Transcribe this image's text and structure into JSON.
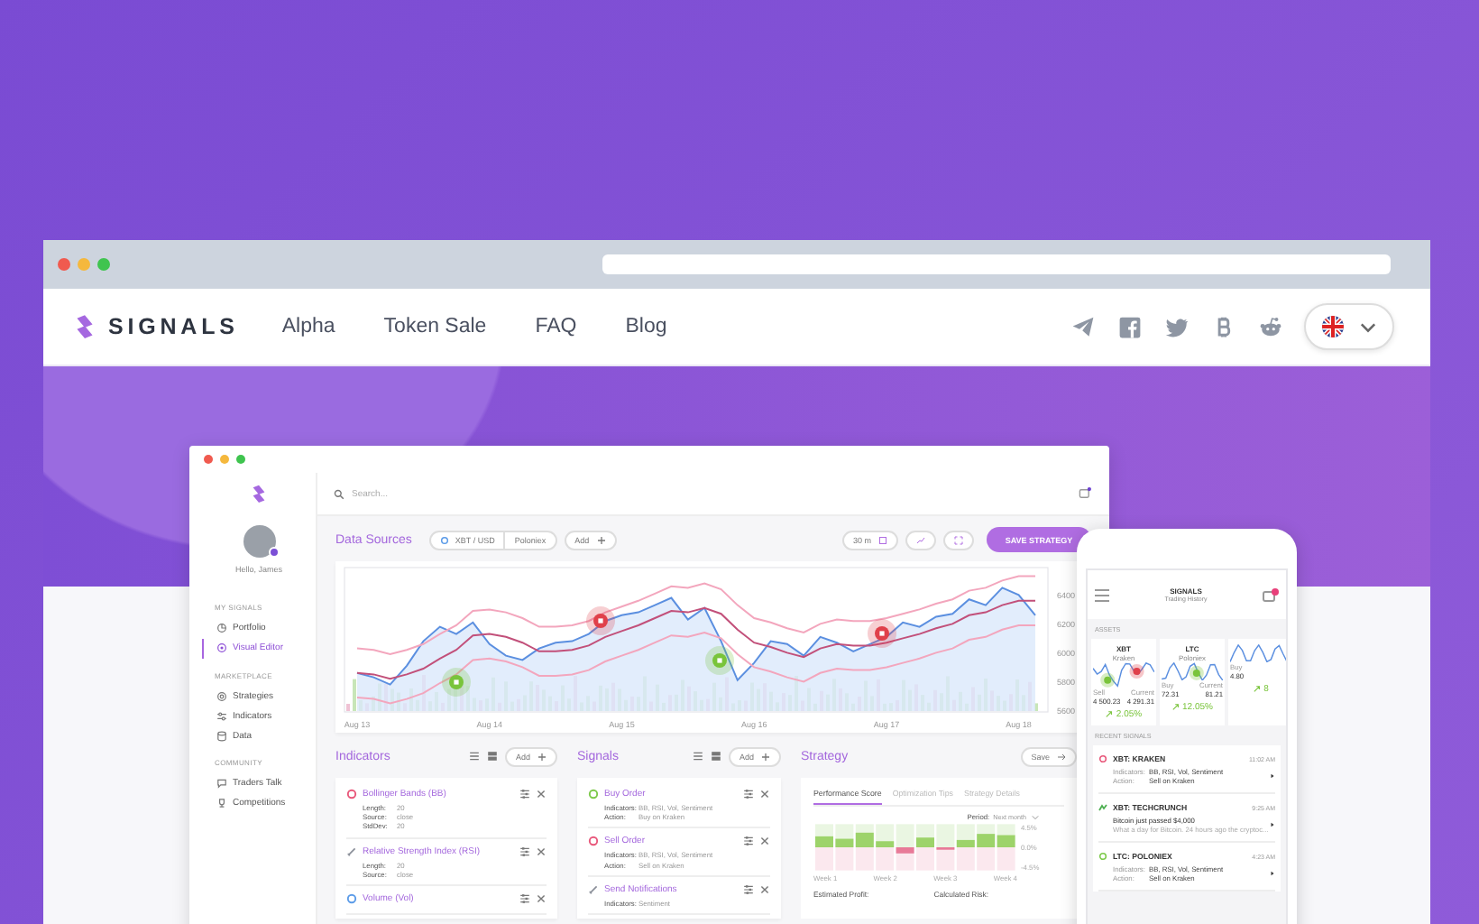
{
  "nav": {
    "logo": "SIGNALS",
    "links": [
      "Alpha",
      "Token Sale",
      "FAQ",
      "Blog"
    ]
  },
  "dashboard": {
    "search": {
      "placeholder": "Search..."
    },
    "user": {
      "greeting": "Hello, James"
    },
    "sidebar": [
      {
        "heading": "MY SIGNALS",
        "items": [
          {
            "label": "Portfolio",
            "selected": false
          },
          {
            "label": "Visual Editor",
            "selected": true
          }
        ]
      },
      {
        "heading": "MARKETPLACE",
        "items": [
          {
            "label": "Strategies",
            "selected": false
          },
          {
            "label": "Indicators",
            "selected": false
          },
          {
            "label": "Data",
            "selected": false
          }
        ]
      },
      {
        "heading": "COMMUNITY",
        "items": [
          {
            "label": "Traders Talk",
            "selected": false
          },
          {
            "label": "Competitions",
            "selected": false
          }
        ]
      }
    ],
    "data_sources": {
      "title": "Data Sources",
      "pair": "XBT / USD",
      "exchange": "Poloniex",
      "add": "Add",
      "interval": "30 m",
      "save": "SAVE STRATEGY"
    },
    "chart": {
      "chart_data": {
        "type": "line",
        "categories": [
          "Aug 13",
          null,
          null,
          null,
          null,
          null,
          null,
          null,
          "Aug 14",
          null,
          null,
          null,
          null,
          null,
          null,
          null,
          "Aug 15",
          null,
          null,
          null,
          null,
          null,
          null,
          null,
          "Aug 16",
          null,
          null,
          null,
          null,
          null,
          null,
          null,
          "Aug 17",
          null,
          null,
          null,
          null,
          null,
          null,
          null,
          "Aug 18",
          null
        ],
        "ylim": [
          5600,
          6600
        ],
        "yticks": [
          6400,
          6200,
          6000,
          5800,
          5600
        ],
        "series": [
          {
            "color": "#5b8fe0",
            "values": [
              5870,
              5840,
              5790,
              5920,
              6090,
              6190,
              6140,
              6220,
              6070,
              5990,
              5960,
              6040,
              6080,
              6090,
              6140,
              6230,
              6270,
              6290,
              6340,
              6390,
              6240,
              6320,
              6090,
              5820,
              5940,
              6090,
              6070,
              5990,
              6120,
              6080,
              6020,
              6070,
              6120,
              6220,
              6190,
              6260,
              6280,
              6380,
              6340,
              6460,
              6410,
              6270
            ]
          },
          {
            "color": "#f3a6bd",
            "values": [
              6040,
              6030,
              6000,
              6030,
              6070,
              6140,
              6200,
              6300,
              6310,
              6290,
              6250,
              6190,
              6190,
              6200,
              6230,
              6290,
              6330,
              6370,
              6420,
              6470,
              6460,
              6490,
              6450,
              6340,
              6250,
              6220,
              6180,
              6150,
              6210,
              6240,
              6230,
              6230,
              6250,
              6280,
              6310,
              6350,
              6380,
              6440,
              6460,
              6510,
              6540,
              6540
            ]
          },
          {
            "color": "#c2507a",
            "values": [
              5870,
              5860,
              5830,
              5860,
              5900,
              5970,
              6030,
              6130,
              6140,
              6120,
              6080,
              6020,
              6020,
              6030,
              6060,
              6120,
              6160,
              6200,
              6250,
              6300,
              6290,
              6320,
              6280,
              6170,
              6080,
              6050,
              6010,
              5980,
              6040,
              6070,
              6060,
              6060,
              6080,
              6110,
              6140,
              6180,
              6210,
              6270,
              6290,
              6340,
              6370,
              6370
            ]
          },
          {
            "color": "#f3a6bd",
            "values": [
              5700,
              5690,
              5660,
              5690,
              5730,
              5800,
              5860,
              5960,
              5970,
              5950,
              5910,
              5850,
              5850,
              5860,
              5890,
              5950,
              5990,
              6030,
              6080,
              6130,
              6120,
              6150,
              6110,
              6000,
              5910,
              5880,
              5840,
              5810,
              5870,
              5900,
              5890,
              5890,
              5910,
              5940,
              5970,
              6010,
              6040,
              6100,
              6120,
              6170,
              6200,
              6200
            ]
          }
        ]
      }
    },
    "indicators": {
      "title": "Indicators",
      "add": "Add",
      "items": [
        {
          "name": "Bollinger Bands (BB)",
          "kind": "dot",
          "color": "#e8577a",
          "params": [
            {
              "label": "Length:",
              "value": "20"
            },
            {
              "label": "Source:",
              "value": "close"
            },
            {
              "label": "StdDev:",
              "value": "20"
            }
          ]
        },
        {
          "name": "Relative Strength Index (RSI)",
          "kind": "pen",
          "color": "#8a8f99",
          "params": [
            {
              "label": "Length:",
              "value": "20"
            },
            {
              "label": "Source:",
              "value": "close"
            }
          ]
        },
        {
          "name": "Volume (Vol)",
          "kind": "dot",
          "color": "#5b9be8"
        }
      ]
    },
    "signals": {
      "title": "Signals",
      "add": "Add",
      "items": [
        {
          "name": "Buy Order",
          "kind": "dot",
          "color": "#7cc94a",
          "params": [
            {
              "label": "Indicators:",
              "value": "BB, RSI, Vol, Sentiment"
            },
            {
              "label": "Action:",
              "value": "Buy on Kraken"
            }
          ]
        },
        {
          "name": "Sell Order",
          "kind": "dot",
          "color": "#e8577a",
          "params": [
            {
              "label": "Indicators:",
              "value": "BB, RSI, Vol, Sentiment"
            },
            {
              "label": "Action:",
              "value": "Sell on Kraken"
            }
          ]
        },
        {
          "name": "Send Notifications",
          "kind": "pen",
          "color": "#8a8f99",
          "params": [
            {
              "label": "Indicators:",
              "value": "Sentiment"
            }
          ]
        }
      ]
    },
    "strategy": {
      "title": "Strategy",
      "save": "Save",
      "tabs": [
        {
          "label": "Performance Score",
          "selected": true
        },
        {
          "label": "Optimization Tips",
          "selected": false
        },
        {
          "label": "Strategy Details",
          "selected": false
        }
      ],
      "period_label": "Period:",
      "period": "Next month",
      "y_labels": [
        "4.5%",
        "0.0%",
        "-4.5%"
      ],
      "week_labels": [
        "Week 1",
        "Week 2",
        "Week 3",
        "Week 4"
      ],
      "footer": [
        "Estimated Profit:",
        "Calculated Risk:"
      ]
    }
  },
  "phone": {
    "title": "SIGNALS",
    "subtitle": "Trading History",
    "assets_heading": "ASSETS",
    "assets": [
      {
        "symbol": "XBT",
        "exchange": "Kraken",
        "left_label": "Sell",
        "left_value": "4 500.23",
        "right_label": "Current",
        "right_value": "4 291.31",
        "change": "2.05%"
      },
      {
        "symbol": "LTC",
        "exchange": "Poloniex",
        "left_label": "Buy",
        "left_value": "72.31",
        "right_label": "Current",
        "right_value": "81.21",
        "change": "12.05%"
      },
      {
        "left_label": "Buy",
        "left_value": "4.80",
        "change": "8"
      }
    ],
    "recent_heading": "RECENT SIGNALS",
    "signals": [
      {
        "kind": "order",
        "color": "#e8577a",
        "title": "XBT: KRAKEN",
        "time": "11:02 AM",
        "lines": [
          {
            "label": "Indicators:",
            "value": "BB, RSI, Vol, Sentiment"
          },
          {
            "label": "Action:",
            "value": "Sell on Kraken"
          }
        ]
      },
      {
        "kind": "news",
        "color": "#4caf50",
        "title": "XBT: TECHCRUNCH",
        "time": "9:25 AM",
        "headline": "Bitcoin just passed $4,000",
        "excerpt": "What a day for Bitcoin. 24 hours ago the cryptoc..."
      },
      {
        "kind": "order",
        "color": "#7cc94a",
        "title": "LTC: POLONIEX",
        "time": "4:23 AM",
        "lines": [
          {
            "label": "Indicators:",
            "value": "BB, RSI, Vol, Sentiment"
          },
          {
            "label": "Action:",
            "value": "Sell on Kraken"
          }
        ]
      }
    ]
  }
}
